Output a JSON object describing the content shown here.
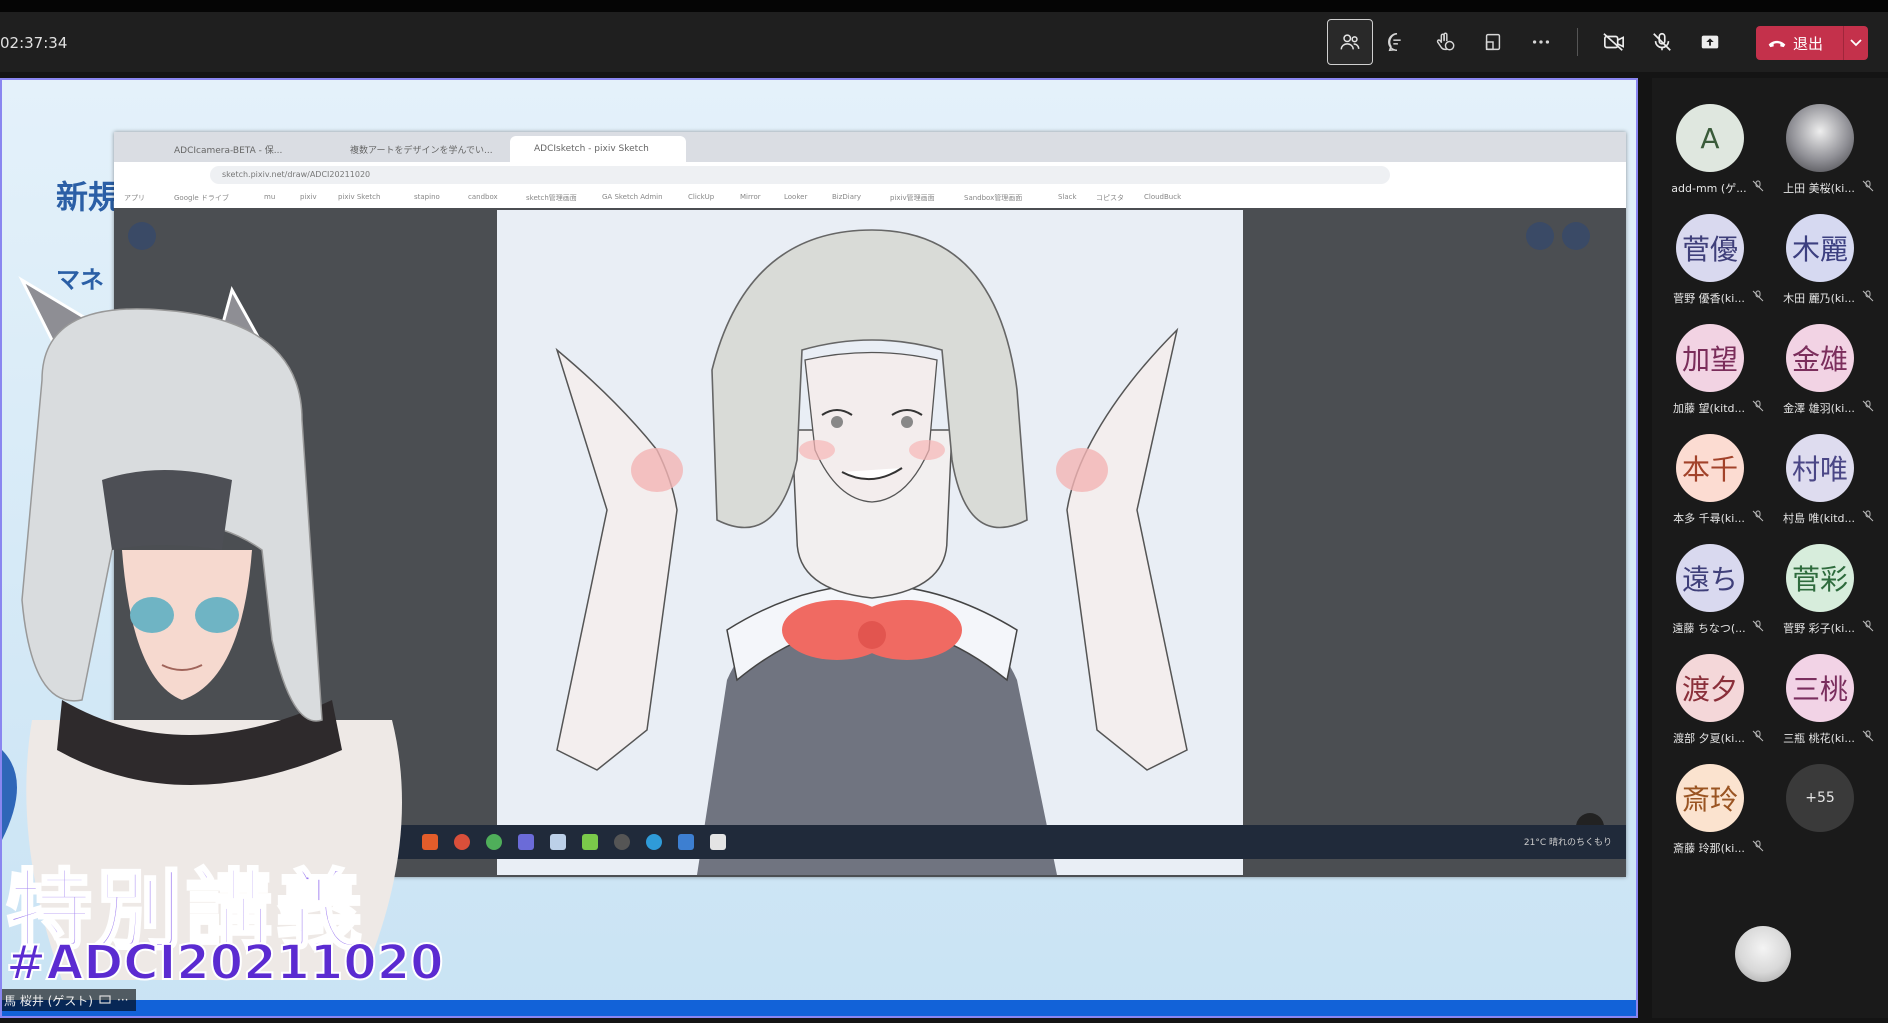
{
  "timer": "02:37:34",
  "toolbar": {
    "leave_label": "退出",
    "icons": [
      "people-icon",
      "chat-icon",
      "reactions-icon",
      "rooms-icon",
      "more-icon",
      "camera-off-icon",
      "mic-off-icon",
      "share-icon",
      "hangup-icon",
      "chevron-down-icon"
    ]
  },
  "slide": {
    "title_part": "新規",
    "sub_part": "マネ",
    "banner": "特別講義",
    "hashtag": "#ADCI20211020"
  },
  "browser": {
    "tabs": [
      "ADCIcamera-BETA - 保...",
      "複数アートをデザインを学んでい...",
      "ADCIsketch - pixiv Sketch"
    ],
    "url": "sketch.pixiv.net/draw/ADCI20211020",
    "bookmarks": [
      "アプリ",
      "Google ドライブ",
      "mu",
      "pixiv",
      "pixiv Sketch",
      "stapino",
      "candbox",
      "sketch管理画面",
      "GA Sketch Admin",
      "ClickUp",
      "Mirror",
      "Looker",
      "BizDiary",
      "pixiv管理画面",
      "Sandbox管理画面",
      "Slack",
      "コピスタ",
      "CloudBuck"
    ],
    "taskbar_status": "21°C 晴れのちくもり"
  },
  "presenter": {
    "name": "馬 桜井 (ゲスト)"
  },
  "participants": [
    {
      "initials": "A",
      "name": "add-mm (ゲ...",
      "bg": "#dfe7df",
      "fg": "#3a5b3a"
    },
    {
      "initials": "",
      "name": "上田 美桜(ki...",
      "bg": "#7a7a7a",
      "fg": "#fff",
      "photo": true
    },
    {
      "initials": "菅優",
      "name": "菅野 優香(ki...",
      "bg": "#d9d9ef",
      "fg": "#3f3f7a"
    },
    {
      "initials": "木麗",
      "name": "木田 麗乃(ki...",
      "bg": "#d6d9f1",
      "fg": "#3c3f80"
    },
    {
      "initials": "加望",
      "name": "加藤 望(kitd...",
      "bg": "#f2d3e3",
      "fg": "#7a2d5a"
    },
    {
      "initials": "金雄",
      "name": "金澤 雄羽(ki...",
      "bg": "#f2d3e4",
      "fg": "#7b2e5c"
    },
    {
      "initials": "本千",
      "name": "本多 千尋(ki...",
      "bg": "#fcdcd2",
      "fg": "#a2422a"
    },
    {
      "initials": "村唯",
      "name": "村島 唯(kitd...",
      "bg": "#dedcef",
      "fg": "#4a4686"
    },
    {
      "initials": "遠ち",
      "name": "遠藤 ちなつ(...",
      "bg": "#d9d9ef",
      "fg": "#3f3f7a"
    },
    {
      "initials": "菅彩",
      "name": "菅野 彩子(ki...",
      "bg": "#d7eddc",
      "fg": "#2e6b3d"
    },
    {
      "initials": "渡夕",
      "name": "渡部 夕夏(ki...",
      "bg": "#f4d7d9",
      "fg": "#8a2f3a"
    },
    {
      "initials": "三桃",
      "name": "三瓶 桃花(ki...",
      "bg": "#f2d3e6",
      "fg": "#7a2e5e"
    },
    {
      "initials": "斎玲",
      "name": "斎藤 玲那(ki...",
      "bg": "#fbe3cf",
      "fg": "#9a5422"
    },
    {
      "initials": "+55",
      "name": "",
      "bg": "#3a3a3a",
      "fg": "#e6e6e6",
      "overflow": true
    }
  ]
}
